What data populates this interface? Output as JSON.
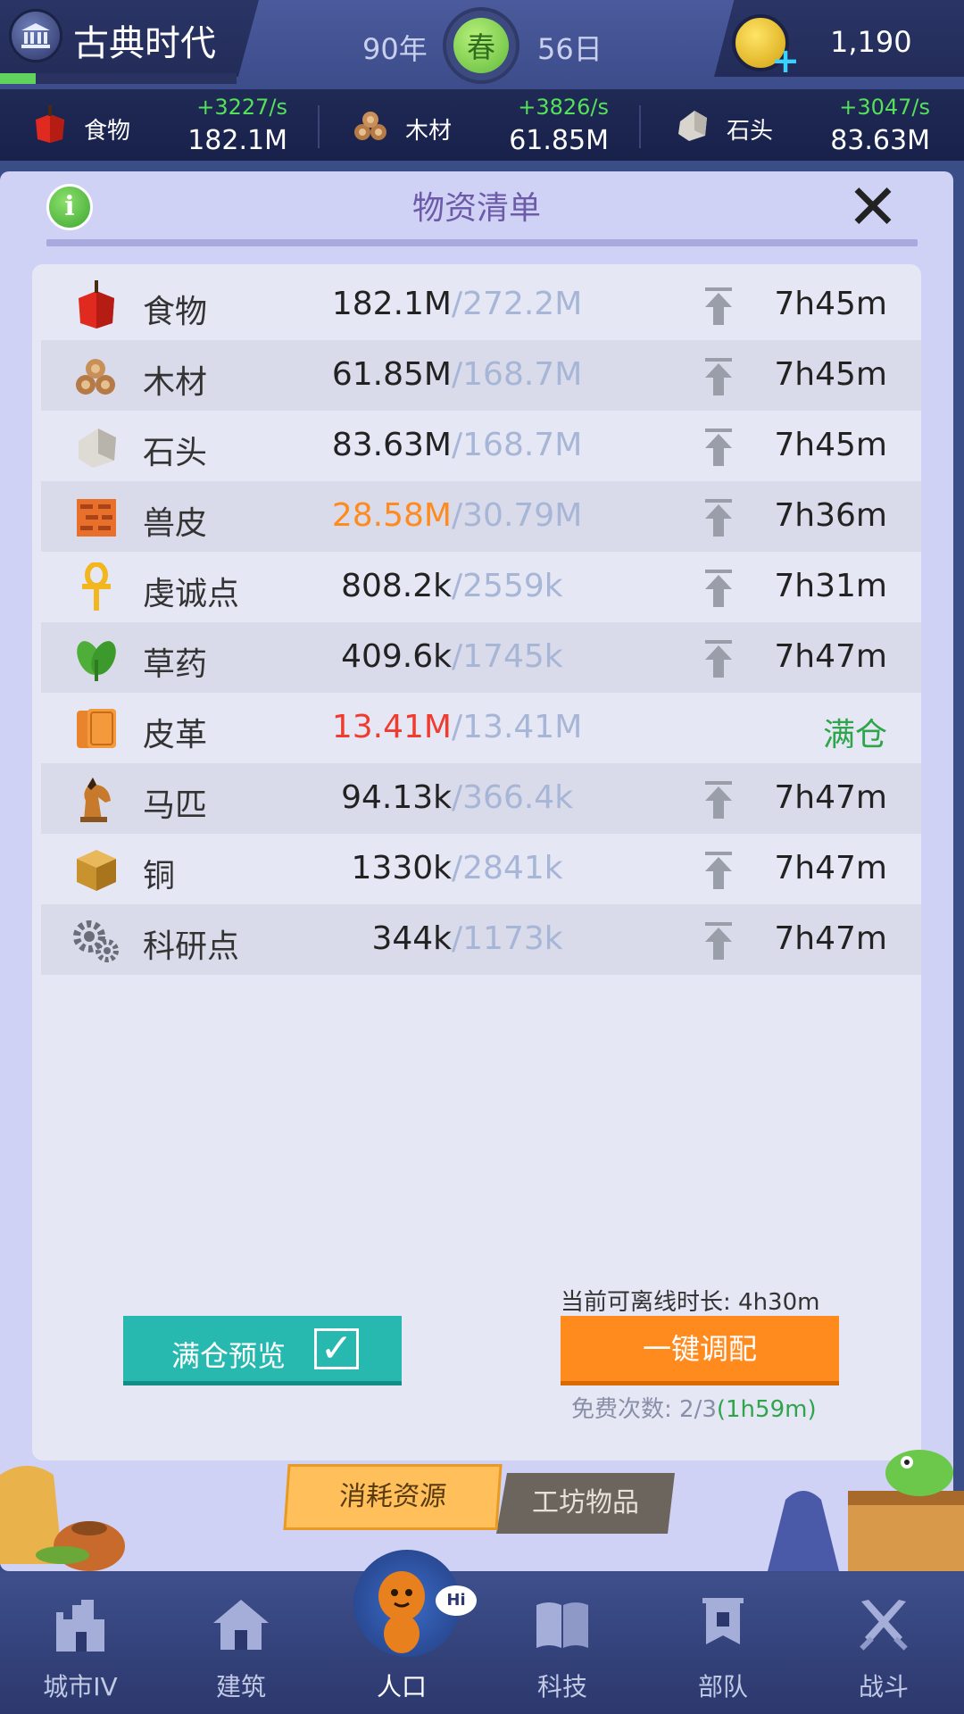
{
  "header": {
    "era_title": "古典时代",
    "era_progress": 0.15,
    "year": "90年",
    "season": "春",
    "day": "56日",
    "coins": "1,190"
  },
  "resource_bar": [
    {
      "name": "食物",
      "rate": "+3227/s",
      "amount": "182.1M",
      "icon": "apple-icon"
    },
    {
      "name": "木材",
      "rate": "+3826/s",
      "amount": "61.85M",
      "icon": "wood-logs-icon"
    },
    {
      "name": "石头",
      "rate": "+3047/s",
      "amount": "83.63M",
      "icon": "stone-icon"
    }
  ],
  "dialog": {
    "title": "物资清单",
    "info_icon": "i",
    "rows": [
      {
        "name": "食物",
        "amount": "182.1M",
        "cap": "/272.2M",
        "time": "7h45m",
        "icon": "apple-icon"
      },
      {
        "name": "木材",
        "amount": "61.85M",
        "cap": "/168.7M",
        "time": "7h45m",
        "icon": "wood-logs-icon"
      },
      {
        "name": "石头",
        "amount": "83.63M",
        "cap": "/168.7M",
        "time": "7h45m",
        "icon": "stone-icon"
      },
      {
        "name": "兽皮",
        "amount": "28.58M",
        "cap": "/30.79M",
        "time": "7h36m",
        "icon": "hide-icon",
        "amount_color": "#ff8a1e"
      },
      {
        "name": "虔诚点",
        "amount": "808.2k",
        "cap": "/2559k",
        "time": "7h31m",
        "icon": "ankh-icon"
      },
      {
        "name": "草药",
        "amount": "409.6k",
        "cap": "/1745k",
        "time": "7h47m",
        "icon": "herb-leaf-icon"
      },
      {
        "name": "皮革",
        "amount": "13.41M",
        "cap": "/13.41M",
        "status": "满仓",
        "icon": "leather-icon",
        "amount_color": "#f03c2e"
      },
      {
        "name": "马匹",
        "amount": "94.13k",
        "cap": "/366.4k",
        "time": "7h47m",
        "icon": "horse-icon"
      },
      {
        "name": "铜",
        "amount": "1330k",
        "cap": "/2841k",
        "time": "7h47m",
        "icon": "copper-block-icon"
      },
      {
        "name": "科研点",
        "amount": "344k",
        "cap": "/1173k",
        "time": "7h47m",
        "icon": "gears-icon"
      }
    ],
    "offline_label": "当前可离线时长: 4h30m",
    "preview_button": "满仓预览",
    "oneclick_button": "一键调配",
    "free_count": "免费次数: 2/3",
    "free_timer": "(1h59m)",
    "tabs": [
      {
        "label": "消耗资源",
        "active": true
      },
      {
        "label": "工坊物品",
        "active": false
      }
    ]
  },
  "nav": [
    {
      "label": "城市IV",
      "icon": "city-castle-icon"
    },
    {
      "label": "建筑",
      "icon": "house-icon"
    },
    {
      "label": "人口",
      "icon": "citizen-icon",
      "active": true
    },
    {
      "label": "科技",
      "icon": "book-icon"
    },
    {
      "label": "部队",
      "icon": "banner-icon"
    },
    {
      "label": "战斗",
      "icon": "crossed-swords-icon"
    }
  ],
  "hi_bubble": "Hi",
  "colors": {
    "accent_green": "#55e05a",
    "full_green": "#2ea54a",
    "warning_orange": "#ff8a1e",
    "danger_red": "#f03c2e",
    "cap_gray": "#a7b6d6",
    "title_purple": "#6d5aa8"
  }
}
